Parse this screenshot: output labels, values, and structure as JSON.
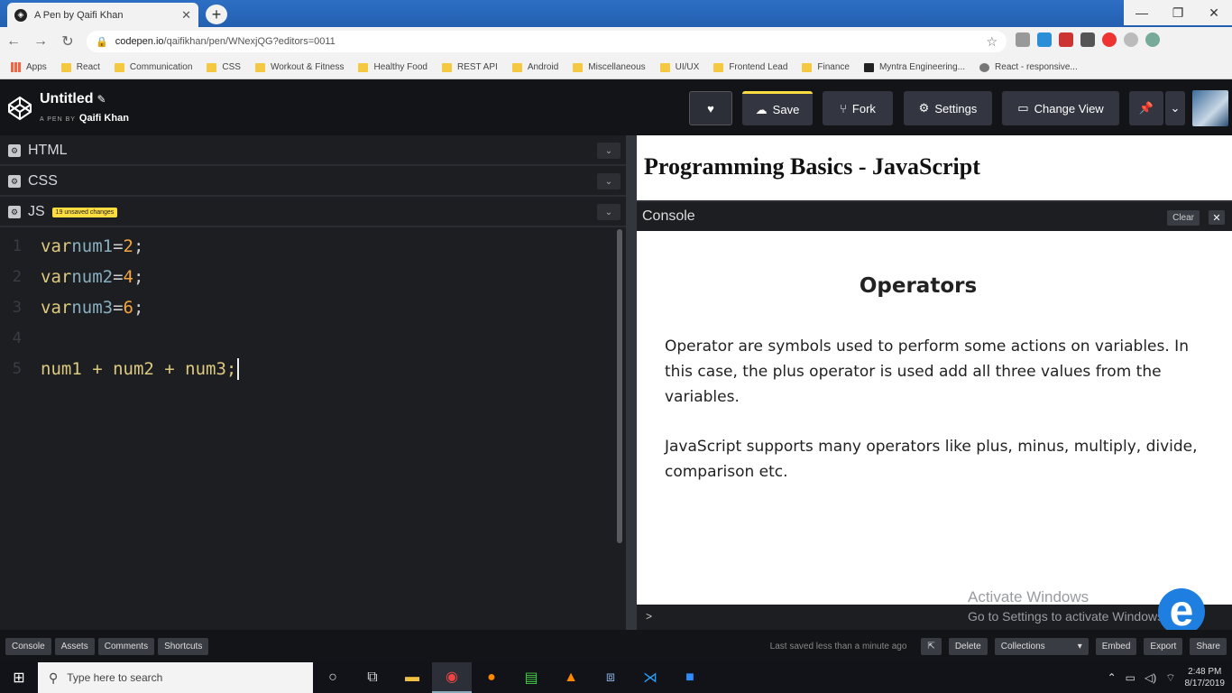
{
  "browser": {
    "tab_title": "A Pen by Qaifi Khan",
    "url_host": "codepen.io",
    "url_path": "/qaifikhan/pen/WNexjQG?editors=0011"
  },
  "bookmarks": [
    "Apps",
    "React",
    "Communication",
    "CSS",
    "Workout & Fitness",
    "Healthy Food",
    "REST API",
    "Android",
    "Miscellaneous",
    "UI/UX",
    "Frontend Lead",
    "Finance",
    "Myntra Engineering...",
    "React - responsive..."
  ],
  "codepen": {
    "title": "Untitled",
    "byline_prefix": "A PEN BY",
    "author": "Qaifi Khan",
    "buttons": {
      "save": "Save",
      "fork": "Fork",
      "settings": "Settings",
      "change_view": "Change View"
    }
  },
  "editors": {
    "html_label": "HTML",
    "css_label": "CSS",
    "js_label": "JS",
    "js_badge": "19 unsaved changes",
    "lines": [
      {
        "n": "1",
        "kw": "var",
        "name": "num1",
        "op": "=",
        "val": "2",
        "end": ";"
      },
      {
        "n": "2",
        "kw": "var",
        "name": "num2",
        "op": "=",
        "val": "4",
        "end": ";"
      },
      {
        "n": "3",
        "kw": "var",
        "name": "num3",
        "op": "=",
        "val": "6",
        "end": ";"
      },
      {
        "n": "4"
      },
      {
        "n": "5",
        "expr": "num1 + num2 + num3;"
      }
    ]
  },
  "preview": {
    "heading": "Programming Basics - JavaScript"
  },
  "console": {
    "label": "Console",
    "clear": "Clear",
    "prompt": ">"
  },
  "slide": {
    "title": "Operators",
    "para1": "Operator are symbols used to perform some actions on variables. In this case, the plus operator is used add all three values from the variables.",
    "para2": "JavaScript supports many operators like plus, minus, multiply, divide, comparison etc."
  },
  "watermark": {
    "title": "Activate Windows",
    "subtitle": "Go to Settings to activate Windows."
  },
  "footer": {
    "left": [
      "Console",
      "Assets",
      "Comments",
      "Shortcuts"
    ],
    "saved": "Last saved less than a minute ago",
    "delete": "Delete",
    "collections": "Collections",
    "embed": "Embed",
    "export": "Export",
    "share": "Share"
  },
  "taskbar": {
    "search_placeholder": "Type here to search",
    "time": "2:48 PM",
    "date": "8/17/2019"
  }
}
